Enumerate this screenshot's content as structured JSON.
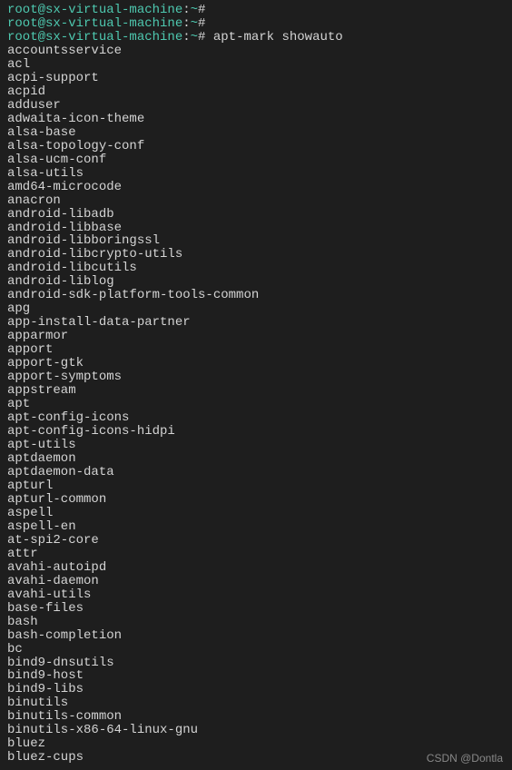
{
  "prompt": {
    "user_host": "root@sx-virtual-machine",
    "separator": ":",
    "path": "~",
    "symbol": "#"
  },
  "empty_prompts": 2,
  "command": "apt-mark showauto",
  "packages": [
    "accountsservice",
    "acl",
    "acpi-support",
    "acpid",
    "adduser",
    "adwaita-icon-theme",
    "alsa-base",
    "alsa-topology-conf",
    "alsa-ucm-conf",
    "alsa-utils",
    "amd64-microcode",
    "anacron",
    "android-libadb",
    "android-libbase",
    "android-libboringssl",
    "android-libcrypto-utils",
    "android-libcutils",
    "android-liblog",
    "android-sdk-platform-tools-common",
    "apg",
    "app-install-data-partner",
    "apparmor",
    "apport",
    "apport-gtk",
    "apport-symptoms",
    "appstream",
    "apt",
    "apt-config-icons",
    "apt-config-icons-hidpi",
    "apt-utils",
    "aptdaemon",
    "aptdaemon-data",
    "apturl",
    "apturl-common",
    "aspell",
    "aspell-en",
    "at-spi2-core",
    "attr",
    "avahi-autoipd",
    "avahi-daemon",
    "avahi-utils",
    "base-files",
    "bash",
    "bash-completion",
    "bc",
    "bind9-dnsutils",
    "bind9-host",
    "bind9-libs",
    "binutils",
    "binutils-common",
    "binutils-x86-64-linux-gnu",
    "bluez",
    "bluez-cups"
  ],
  "watermark": "CSDN @Dontla"
}
